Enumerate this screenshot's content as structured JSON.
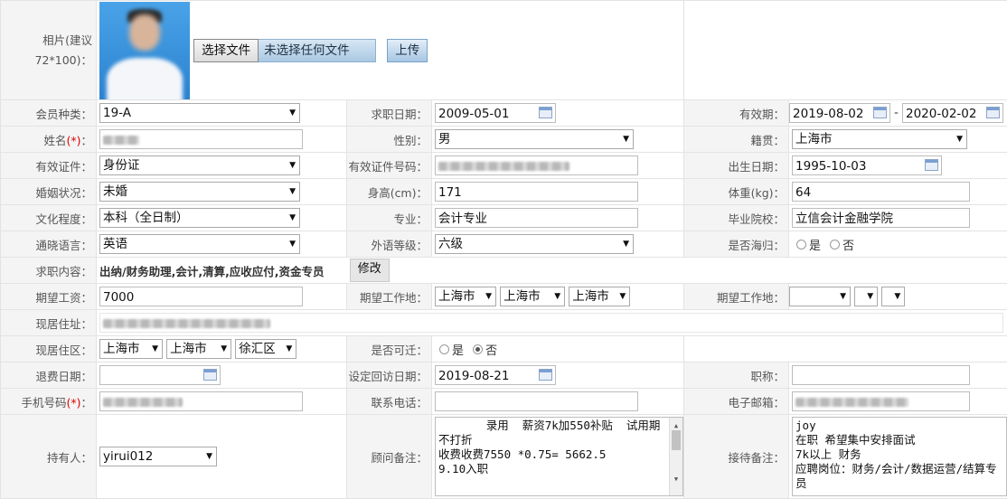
{
  "photo": {
    "label": "相片(建议72*100)：",
    "choose_btn": "选择文件",
    "no_file": "未选择任何文件",
    "upload_btn": "上传"
  },
  "member_type": {
    "label": "会员种类：",
    "value": "19-A"
  },
  "job_date": {
    "label": "求职日期：",
    "value": "2009-05-01"
  },
  "validity": {
    "label": "有效期：",
    "from": "2019-08-02",
    "sep": "-",
    "to": "2020-02-02"
  },
  "name": {
    "label": "姓名",
    "req": "(*)",
    "colon": "："
  },
  "gender": {
    "label": "性别：",
    "value": "男"
  },
  "native_place": {
    "label": "籍贯：",
    "value": "上海市"
  },
  "id_type": {
    "label": "有效证件：",
    "value": "身份证"
  },
  "id_number": {
    "label": "有效证件号码："
  },
  "birth": {
    "label": "出生日期：",
    "value": "1995-10-03"
  },
  "marital": {
    "label": "婚姻状况：",
    "value": "未婚"
  },
  "height": {
    "label": "身高(cm)：",
    "value": "171"
  },
  "weight": {
    "label": "体重(kg)：",
    "value": "64"
  },
  "education": {
    "label": "文化程度：",
    "value": "本科（全日制）"
  },
  "major": {
    "label": "专业：",
    "value": "会计专业"
  },
  "school": {
    "label": "毕业院校：",
    "value": "立信会计金融学院"
  },
  "language": {
    "label": "通晓语言：",
    "value": "英语"
  },
  "lang_level": {
    "label": "外语等级：",
    "value": "六级"
  },
  "overseas": {
    "label": "是否海归：",
    "yes": "是",
    "no": "否"
  },
  "job_content": {
    "label": "求职内容：",
    "value": "出纳/财务助理,会计,清算,应收应付,资金专员",
    "edit_btn": "修改"
  },
  "salary": {
    "label": "期望工资：",
    "value": "7000"
  },
  "work_place1": {
    "label": "期望工作地：",
    "p": "上海市",
    "c": "上海市",
    "d": "上海市"
  },
  "work_place2": {
    "label": "期望工作地："
  },
  "address": {
    "label": "现居住址："
  },
  "district": {
    "label": "现居住区：",
    "p": "上海市",
    "c": "上海市",
    "d": "徐汇区"
  },
  "relocate": {
    "label": "是否可迁：",
    "yes": "是",
    "no": "否"
  },
  "refund_date": {
    "label": "退费日期："
  },
  "revisit_date": {
    "label": "设定回访日期：",
    "value": "2019-08-21"
  },
  "title_rank": {
    "label": "职称："
  },
  "mobile": {
    "label": "手机号码",
    "req": "(*)",
    "colon": "："
  },
  "phone": {
    "label": "联系电话："
  },
  "email": {
    "label": "电子邮箱："
  },
  "holder": {
    "label": "持有人：",
    "value": "yirui012"
  },
  "advisor_note": {
    "label": "顾问备注：",
    "text": "       录用  薪资7k加550补贴  试用期不打折\n收费收费7550 *0.75= 5662.5\n9.10入职"
  },
  "reception_note": {
    "label": "接待备注：",
    "text": "joy\n在职 希望集中安排面试\n7k以上 财务\n应聘岗位：财务/会计/数据运营/结算专员"
  }
}
